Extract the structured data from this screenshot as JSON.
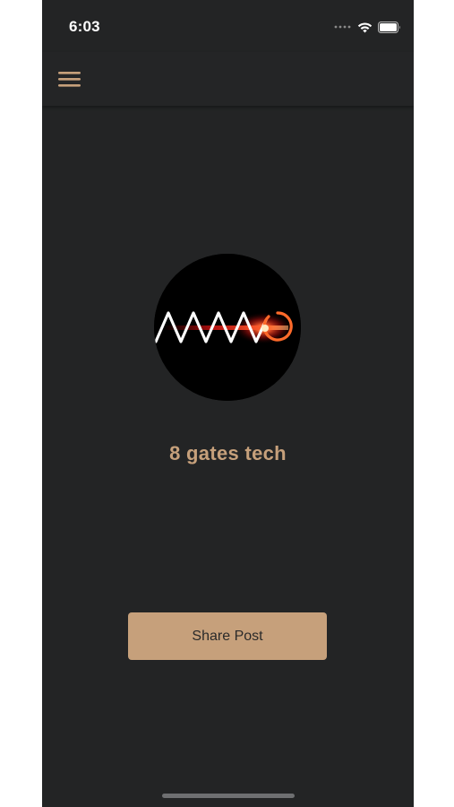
{
  "status_bar": {
    "time": "6:03",
    "icons": [
      "signal-dots-icon",
      "wifi-icon",
      "battery-icon"
    ]
  },
  "nav": {
    "menu_icon": "hamburger-menu-icon"
  },
  "profile": {
    "logo": "brand-logo",
    "name": "8 gates tech"
  },
  "actions": {
    "share_label": "Share Post"
  },
  "colors": {
    "background": "#232425",
    "accent": "#c6a07b",
    "button_text": "#2a2a2a"
  }
}
